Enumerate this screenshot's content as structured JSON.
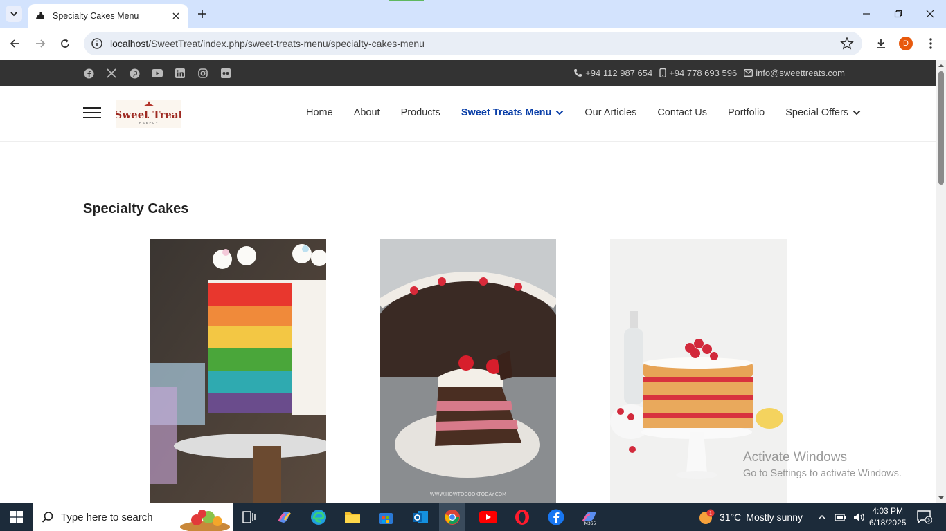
{
  "browser": {
    "tab_title": "Specialty Cakes Menu",
    "url_host": "localhost",
    "url_path": "/SweetTreat/index.php/sweet-treats-menu/specialty-cakes-menu",
    "profile_initial": "D"
  },
  "topbar": {
    "social": [
      "facebook-icon",
      "x-icon",
      "pinterest-icon",
      "youtube-icon",
      "linkedin-icon",
      "instagram-icon",
      "flickr-icon"
    ],
    "phone": "+94 112 987 654",
    "mobile": "+94 778 693 596",
    "email": "info@sweettreats.com"
  },
  "header": {
    "logo_text": "Sweet Treat",
    "logo_sub": "BAKERY",
    "menu": [
      {
        "label": "Home"
      },
      {
        "label": "About"
      },
      {
        "label": "Products"
      },
      {
        "label": "Sweet Treats Menu",
        "active": true,
        "dropdown": true
      },
      {
        "label": "Our Articles"
      },
      {
        "label": "Contact Us"
      },
      {
        "label": "Portfolio"
      },
      {
        "label": "Special Offers",
        "dropdown": true
      }
    ]
  },
  "main": {
    "section_title": "Specialty Cakes",
    "cakes": [
      {
        "image": "rainbow-layer-cake"
      },
      {
        "image": "black-forest-cake-slice"
      },
      {
        "image": "raspberry-naked-cake"
      }
    ],
    "image_credit": "WWW.HOWTOCOOKTODAY.COM"
  },
  "watermark": {
    "line1": "Activate Windows",
    "line2": "Go to Settings to activate Windows."
  },
  "taskbar": {
    "search_placeholder": "Type here to search",
    "weather_temp": "31°C",
    "weather_text": "Mostly sunny",
    "time": "4:03 PM",
    "date": "6/18/2025",
    "notification_count": "3",
    "weather_badge": "1"
  }
}
